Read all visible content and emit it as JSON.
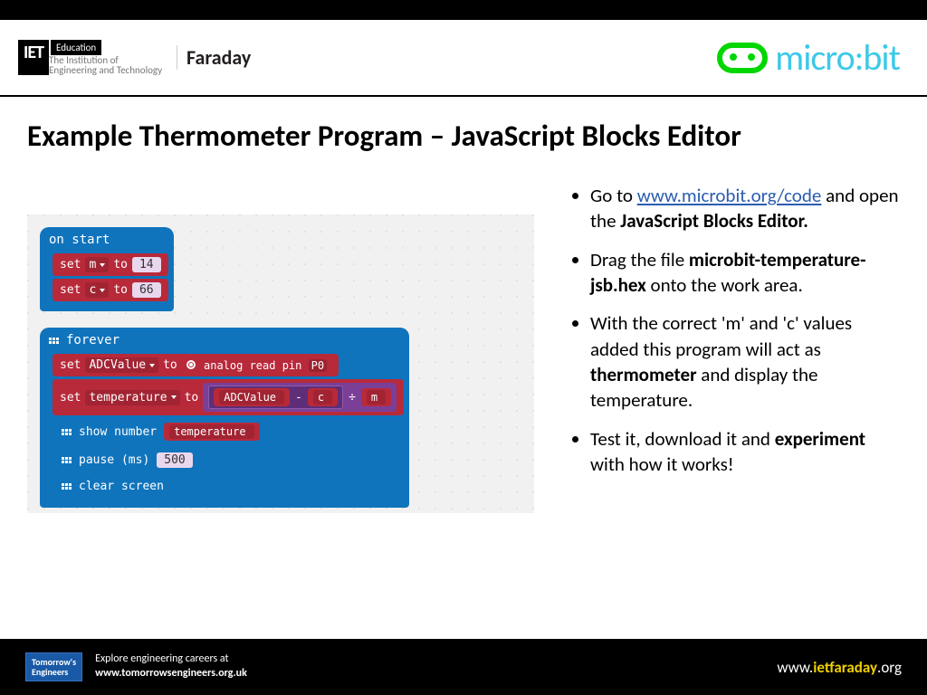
{
  "header": {
    "iet_mark": "IET",
    "iet_education": "Education",
    "iet_sub1": "The Institution of",
    "iet_sub2": "Engineering and Technology",
    "faraday": "Faraday",
    "microbit": "micro:bit"
  },
  "title": "Example Thermometer Program – JavaScript Blocks Editor",
  "blocks": {
    "on_start": "on start",
    "set": "set",
    "to": "to",
    "var_m": "m",
    "var_c": "c",
    "val_m": "14",
    "val_c": "66",
    "forever": "forever",
    "var_adc": "ADCValue",
    "analog_read": "analog read pin",
    "pin": "P0",
    "var_temp": "temperature",
    "minus": "-",
    "divide": "÷",
    "show_number": "show number",
    "pause": "pause (ms)",
    "pause_val": "500",
    "clear": "clear screen"
  },
  "bullets": {
    "b1a": "Go to ",
    "b1link": "www.microbit.org/code",
    "b1b": " and open the ",
    "b1c": "JavaScript Blocks Editor.",
    "b2a": "Drag the file ",
    "b2b": "microbit-temperature-jsb.hex",
    "b2c": " onto the work area.",
    "b3a": "With the correct 'm' and 'c' values added this program will act as ",
    "b3b": "thermometer",
    "b3c": " and display the temperature.",
    "b4a": "Test it, download it and ",
    "b4b": "experiment",
    "b4c": " with how it works!"
  },
  "footer": {
    "te1": "Tomorrow's",
    "te2": "Engineers",
    "line1": "Explore engineering careers at",
    "line2": "www.tomorrowsengineers.org.uk",
    "url_pre": "www.",
    "url_mid": "ietfaraday",
    "url_post": ".org"
  }
}
